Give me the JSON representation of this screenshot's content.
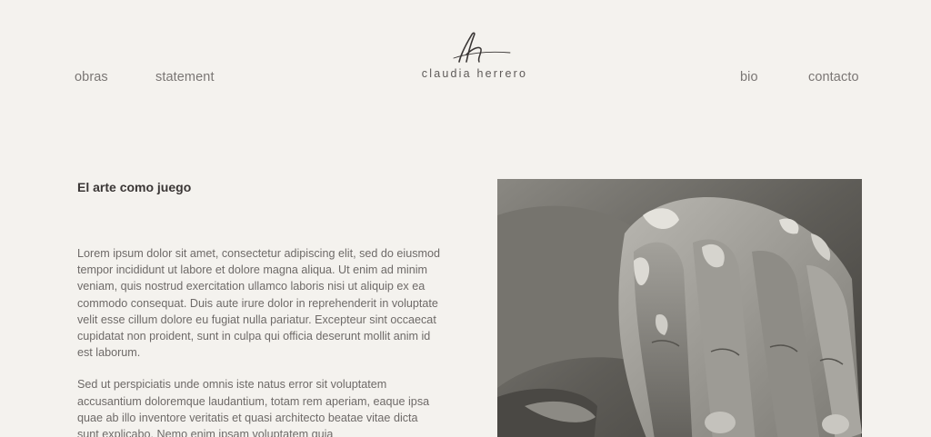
{
  "nav": {
    "left": [
      {
        "label": "obras"
      },
      {
        "label": "statement"
      }
    ],
    "right": [
      {
        "label": "bio"
      },
      {
        "label": "contacto"
      }
    ]
  },
  "logo": {
    "name": "claudia herrero"
  },
  "article": {
    "title": "El arte como juego",
    "paragraphs": [
      "Lorem ipsum dolor sit amet, consectetur adipiscing elit, sed do eiusmod tempor incididunt ut labore et dolore magna aliqua. Ut enim ad minim veniam, quis nostrud exercitation ullamco laboris nisi ut aliquip ex ea commodo consequat. Duis aute irure dolor in reprehenderit in voluptate velit esse cillum dolore eu fugiat nulla pariatur. Excepteur sint occaecat cupidatat non proident, sunt in culpa qui officia deserunt mollit anim id est laborum.",
      "Sed ut perspiciatis unde omnis iste natus error sit voluptatem accusantium doloremque laudantium, totam rem aperiam, eaque ipsa quae ab illo inventore veritatis et quasi architecto beatae vitae dicta sunt explicabo. Nemo enim ipsam voluptatem quia"
    ]
  },
  "colors": {
    "background": "#f4f2ee",
    "nav_text": "#7a7674",
    "title_text": "#3a3635",
    "body_text": "#6e6a68"
  }
}
